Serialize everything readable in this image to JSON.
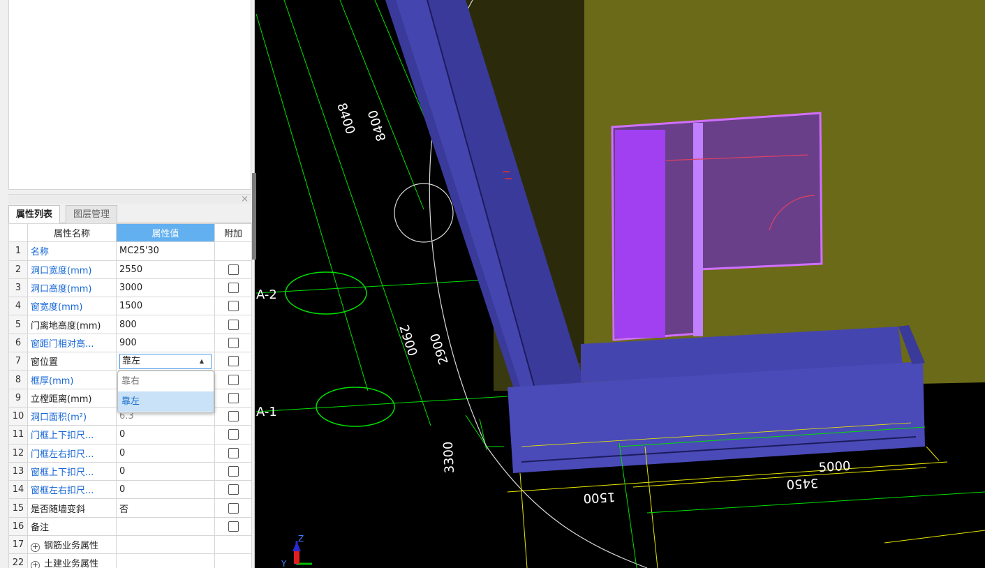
{
  "panel": {
    "close_glyph": "×",
    "tabs": [
      {
        "label": "属性列表",
        "active": true
      },
      {
        "label": "图层管理",
        "active": false
      }
    ],
    "columns": {
      "num": "",
      "name": "属性名称",
      "value": "属性值",
      "extra": "附加"
    },
    "rows": [
      {
        "num": "1",
        "name": "名称",
        "value": "MC25'30",
        "name_color": "blue",
        "checkbox": false
      },
      {
        "num": "2",
        "name": "洞口宽度(mm)",
        "value": "2550",
        "name_color": "blue",
        "checkbox": true
      },
      {
        "num": "3",
        "name": "洞口高度(mm)",
        "value": "3000",
        "name_color": "blue",
        "checkbox": true
      },
      {
        "num": "4",
        "name": "窗宽度(mm)",
        "value": "1500",
        "name_color": "blue",
        "checkbox": true
      },
      {
        "num": "5",
        "name": "门离地高度(mm)",
        "value": "800",
        "name_color": "black",
        "checkbox": true
      },
      {
        "num": "6",
        "name": "窗距门相对高...",
        "value": "900",
        "name_color": "blue",
        "checkbox": true
      },
      {
        "num": "7",
        "name": "窗位置",
        "value": "靠左",
        "name_color": "black",
        "checkbox": true,
        "selected": true,
        "editing": true
      },
      {
        "num": "8",
        "name": "框厚(mm)",
        "value": "",
        "name_color": "blue",
        "checkbox": true
      },
      {
        "num": "9",
        "name": "立樘距离(mm)",
        "value": "",
        "name_color": "black",
        "checkbox": true
      },
      {
        "num": "10",
        "name": "洞口面积(m²)",
        "value": "6.3",
        "name_color": "blue",
        "checkbox": true,
        "value_grey": true
      },
      {
        "num": "11",
        "name": "门框上下扣尺...",
        "value": "0",
        "name_color": "blue",
        "checkbox": true
      },
      {
        "num": "12",
        "name": "门框左右扣尺...",
        "value": "0",
        "name_color": "blue",
        "checkbox": true
      },
      {
        "num": "13",
        "name": "窗框上下扣尺...",
        "value": "0",
        "name_color": "blue",
        "checkbox": true
      },
      {
        "num": "14",
        "name": "窗框左右扣尺...",
        "value": "0",
        "name_color": "blue",
        "checkbox": true
      },
      {
        "num": "15",
        "name": "是否随墙变斜",
        "value": "否",
        "name_color": "black",
        "checkbox": true
      },
      {
        "num": "16",
        "name": "备注",
        "value": "",
        "name_color": "black",
        "checkbox": true
      },
      {
        "num": "17",
        "name": "钢筋业务属性",
        "value": "",
        "name_color": "black",
        "checkbox": false,
        "group": true
      },
      {
        "num": "22",
        "name": "土建业务属性",
        "value": "",
        "name_color": "black",
        "checkbox": false,
        "group": true
      }
    ],
    "dropdown_arrow": "▲",
    "dropdown_options": [
      {
        "label": "靠右",
        "active": false
      },
      {
        "label": "靠左",
        "active": true
      }
    ],
    "expander_glyph": "+"
  },
  "viewport": {
    "axis_labels": [
      "A-2",
      "A-1"
    ],
    "dimension_texts": [
      "8400",
      "8400",
      "2900",
      "2900",
      "5000",
      "3450",
      "1500",
      "3300"
    ],
    "axis_letters": {
      "z": "Z",
      "y": "Y"
    },
    "colors": {
      "background": "#000000",
      "olive_wall": "#6b6a18",
      "blue_wall": "#4545b0",
      "purple_door": "#a040f0",
      "grid_green": "#00e000",
      "dim_yellow": "#e8e800",
      "accent_blue": "#62b0f0"
    }
  }
}
